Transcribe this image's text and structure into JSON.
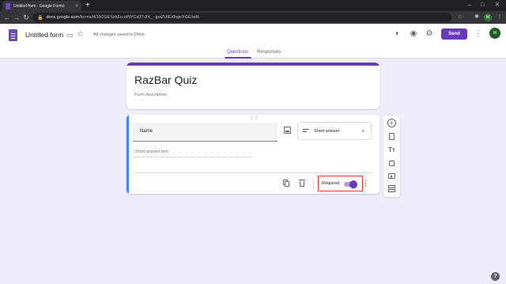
{
  "browser": {
    "tab_title": "Untitled form - Google Forms",
    "tab_close": "×",
    "new_tab": "+",
    "url_domain": "docs.google.com",
    "url_path": "/forms/d/1lICGESzkEo-nPlYCdJT-8X_--jpaZUlEXIiqieXGE/edit",
    "back": "←",
    "forward": "→",
    "reload": "↻",
    "lock": "🔒",
    "star": "☆",
    "puzzle": "✱",
    "avatar_initials": "M",
    "menu": "⋮",
    "minimize": "–",
    "maximize": "□",
    "close": "✕"
  },
  "header": {
    "doc_title": "Untitled form",
    "save_status": "All changes saved in Drive",
    "send_label": "Send",
    "avatar_initials": "M",
    "icons": {
      "palette": "◐",
      "preview": "◉",
      "settings": "⚙",
      "more": "⋮",
      "folder": "▭",
      "star": "☆"
    }
  },
  "tabs": [
    {
      "label": "Questions",
      "active": true
    },
    {
      "label": "Responses",
      "active": false
    }
  ],
  "form": {
    "title": "RazBar Quiz",
    "description_placeholder": "Form description"
  },
  "question": {
    "title": "Name",
    "type_label": "Short answer",
    "answer_placeholder": "Short answer text",
    "required_label": "Required",
    "required": true,
    "drag_handle": "⠿⠿",
    "caret": "▾",
    "more": "⋮"
  },
  "side_toolbar": {
    "add": "+",
    "title_text": "Tт"
  },
  "help": "?",
  "colors": {
    "accent": "#673ab7",
    "page_bg": "#f0ebf8",
    "active_border": "#4285f4",
    "highlight": "#e53935"
  }
}
